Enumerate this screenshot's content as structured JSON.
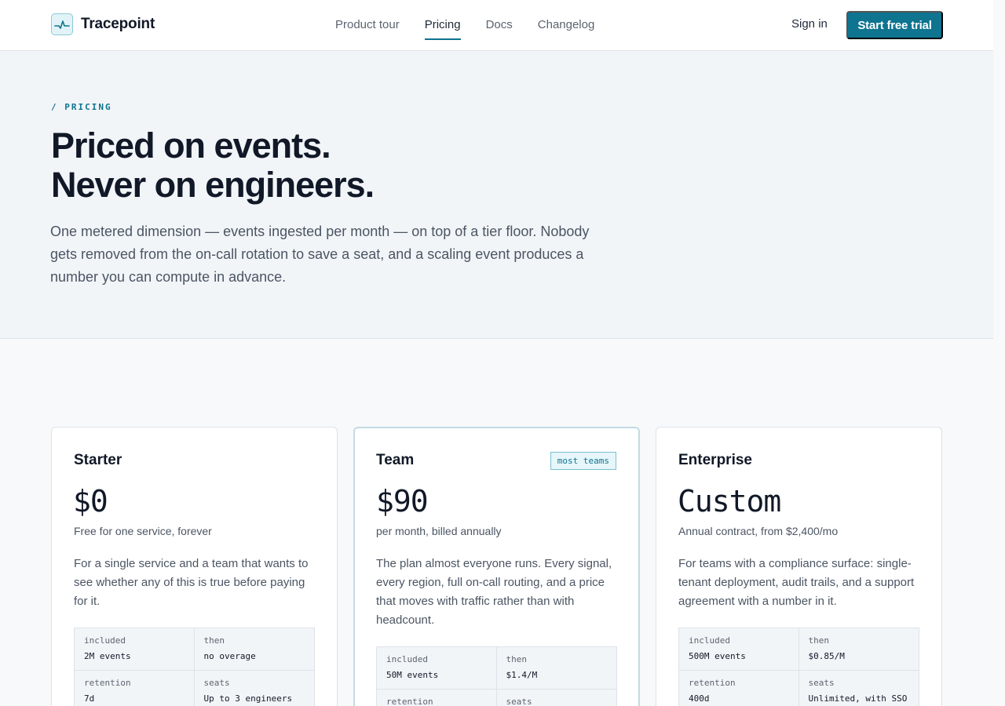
{
  "brand": {
    "name": "Tracepoint",
    "icon": "pulse-icon"
  },
  "nav": {
    "items": [
      {
        "label": "Product tour",
        "active": false
      },
      {
        "label": "Pricing",
        "active": true
      },
      {
        "label": "Docs",
        "active": false
      },
      {
        "label": "Changelog",
        "active": false
      }
    ],
    "sign_in": "Sign in",
    "cta": "Start free trial"
  },
  "hero": {
    "eyebrow": "/ PRICING",
    "headline_1": "Priced on events.",
    "headline_2": "Never on engineers.",
    "lede": "One metered dimension — events ingested per month — on top of a tier floor. Nobody gets removed from the on-call rotation to save a seat, and a scaling event produces a number you can compute in advance."
  },
  "plans": [
    {
      "name": "Starter",
      "price": "$0",
      "price_note": "Free for one service, forever",
      "description": "For a single service and a team that wants to see whether any of this is true before paying for it.",
      "specs": [
        {
          "key": "included",
          "value": "2M events"
        },
        {
          "key": "then",
          "value": "no overage"
        },
        {
          "key": "retention",
          "value": "7d"
        },
        {
          "key": "seats",
          "value": "Up to 3 engineers"
        }
      ]
    },
    {
      "name": "Team",
      "badge": "most teams",
      "price": "$90",
      "price_note": "per month, billed annually",
      "description": "The plan almost everyone runs. Every signal, every region, full on-call routing, and a price that moves with traffic rather than with headcount.",
      "specs": [
        {
          "key": "included",
          "value": "50M events"
        },
        {
          "key": "then",
          "value": "$1.4/M"
        },
        {
          "key": "retention",
          "value": ""
        },
        {
          "key": "seats",
          "value": ""
        }
      ]
    },
    {
      "name": "Enterprise",
      "price": "Custom",
      "price_note": "Annual contract, from $2,400/mo",
      "description": "For teams with a compliance surface: single-tenant deployment, audit trails, and a support agreement with a number in it.",
      "specs": [
        {
          "key": "included",
          "value": "500M events"
        },
        {
          "key": "then",
          "value": "$0.85/M"
        },
        {
          "key": "retention",
          "value": "400d"
        },
        {
          "key": "seats",
          "value": "Unlimited, with SSO"
        }
      ]
    }
  ],
  "colors": {
    "accent": "#0e7490",
    "background": "#f7f9fb",
    "text": "#111827"
  }
}
